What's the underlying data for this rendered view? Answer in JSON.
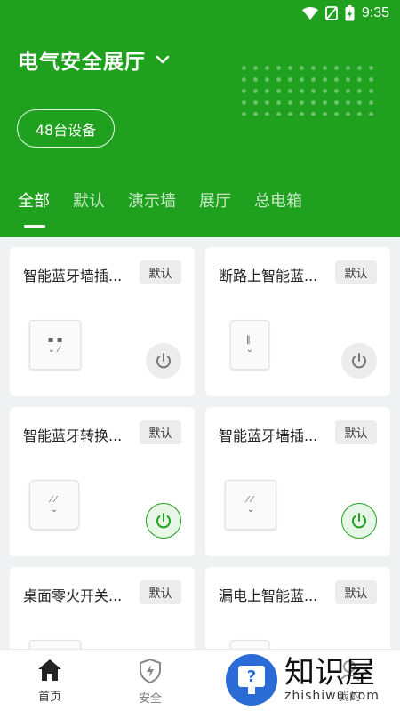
{
  "status_bar": {
    "time": "9:35"
  },
  "header": {
    "title": "电气安全展厅",
    "device_chip": "48台设备",
    "tabs": [
      {
        "label": "全部",
        "active": true
      },
      {
        "label": "默认",
        "active": false
      },
      {
        "label": "演示墙",
        "active": false
      },
      {
        "label": "展厅",
        "active": false
      },
      {
        "label": "总电箱",
        "active": false
      }
    ],
    "accent_color": "#1fa11f"
  },
  "devices": [
    {
      "name": "智能蓝牙墙插...",
      "group": "默认",
      "power": "off",
      "icon": "wall-socket-icon"
    },
    {
      "name": "断路上智能蓝...",
      "group": "默认",
      "power": "off",
      "icon": "breaker-socket-icon"
    },
    {
      "name": "智能蓝牙转换...",
      "group": "默认",
      "power": "on",
      "icon": "adapter-socket-icon"
    },
    {
      "name": "智能蓝牙墙插...",
      "group": "默认",
      "power": "on",
      "icon": "wall-socket-icon"
    },
    {
      "name": "桌面零火开关...",
      "group": "默认",
      "power": "off",
      "icon": "switch-panel-icon"
    },
    {
      "name": "漏电上智能蓝...",
      "group": "默认",
      "power": "off",
      "icon": "leakage-socket-icon"
    }
  ],
  "bottom_nav": [
    {
      "label": "首页",
      "icon": "home-icon",
      "active": true
    },
    {
      "label": "安全",
      "icon": "shield-icon",
      "active": false
    },
    {
      "label": "我的",
      "icon": "profile-icon",
      "active": false
    }
  ],
  "watermark": {
    "title": "知识屋",
    "subtitle": "zhishiwu.com"
  }
}
